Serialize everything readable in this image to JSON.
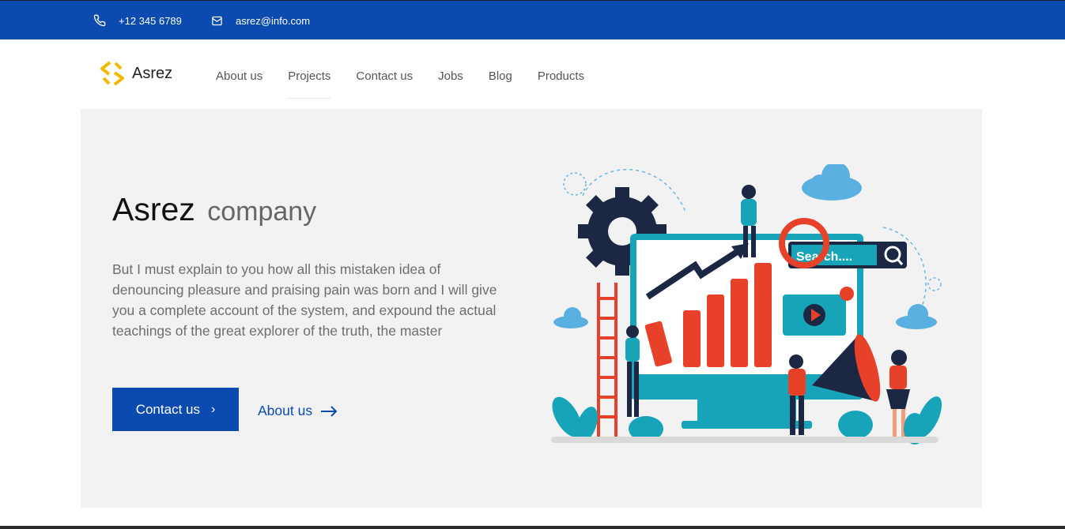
{
  "topbar": {
    "phone": "+12 345 6789",
    "email": "asrez@info.com"
  },
  "header": {
    "logo_text": "Asrez",
    "nav": [
      "About us",
      "Projects",
      "Contact us",
      "Jobs",
      "Blog",
      "Products"
    ],
    "active_nav": "Projects"
  },
  "hero": {
    "title_main": "Asrez",
    "title_light": "company",
    "description": "But I must explain to you how all this mistaken idea of denouncing pleasure and praising pain was born and I will give you a complete account of the system, and expound the actual teachings of the great explorer of the truth, the master",
    "primary_button": "Contact us",
    "secondary_link": "About us",
    "illustration_search_text": "Search...."
  },
  "colors": {
    "brand_blue": "#0b4bb0",
    "logo_yellow": "#f5b800",
    "hero_bg": "#f2f2f2",
    "teal": "#17a3b8",
    "red": "#e8412a"
  }
}
